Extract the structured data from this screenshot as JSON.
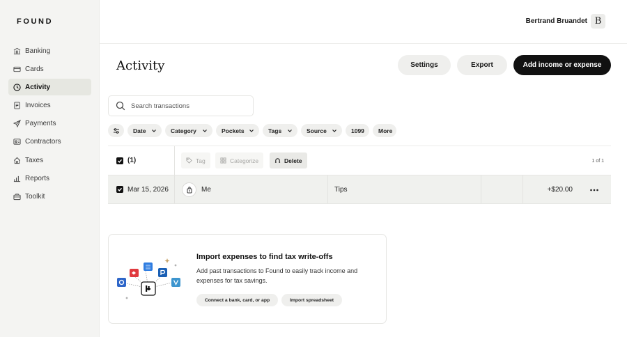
{
  "brand": {
    "logo_text": "FOUND"
  },
  "sidebar": {
    "items": [
      {
        "label": "Banking",
        "icon": "bank-icon",
        "active": false
      },
      {
        "label": "Cards",
        "icon": "card-icon",
        "active": false
      },
      {
        "label": "Activity",
        "icon": "clock-icon",
        "active": true
      },
      {
        "label": "Invoices",
        "icon": "invoice-icon",
        "active": false
      },
      {
        "label": "Payments",
        "icon": "send-icon",
        "active": false
      },
      {
        "label": "Contractors",
        "icon": "contractor-icon",
        "active": false
      },
      {
        "label": "Taxes",
        "icon": "home-icon",
        "active": false
      },
      {
        "label": "Reports",
        "icon": "bar-chart-icon",
        "active": false
      },
      {
        "label": "Toolkit",
        "icon": "toolbox-icon",
        "active": false
      }
    ]
  },
  "header": {
    "user_name": "Bertrand Bruandet",
    "avatar_initial": "B"
  },
  "page": {
    "title": "Activity",
    "settings_label": "Settings",
    "export_label": "Export",
    "add_label": "Add income or expense"
  },
  "search": {
    "placeholder": "Search transactions",
    "value": ""
  },
  "filters": {
    "items": [
      {
        "label": "Date"
      },
      {
        "label": "Category"
      },
      {
        "label": "Pockets"
      },
      {
        "label": "Tags"
      },
      {
        "label": "Source"
      },
      {
        "label": "1099"
      },
      {
        "label": "More"
      }
    ]
  },
  "selection": {
    "count_label": "(1)",
    "tag_label": "Tag",
    "categorize_label": "Categorize",
    "delete_label": "Delete",
    "pager": "1 of 1"
  },
  "transactions": [
    {
      "date": "Mar 15, 2026",
      "merchant": "Me",
      "category": "Tips",
      "amount": "+$20.00",
      "checked": true
    }
  ],
  "import_card": {
    "title": "Import expenses to find tax write-offs",
    "text": "Add past transactions to Found to easily track income and expenses for tax savings.",
    "connect_label": "Connect a bank, card, or app",
    "spreadsheet_label": "Import spreadsheet"
  },
  "colors": {
    "sidebar_bg": "#f4f4f2",
    "active_bg": "#e6e7e1",
    "primary_btn": "#111111",
    "secondary_btn": "#efefed",
    "selected_row": "#f0f1ee"
  }
}
